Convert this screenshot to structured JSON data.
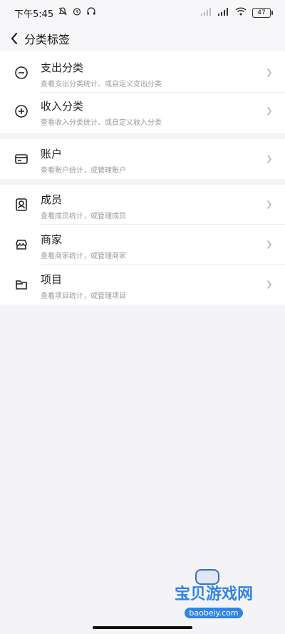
{
  "status_bar": {
    "time": "下午5:45",
    "battery": "47"
  },
  "header": {
    "title": "分类标签"
  },
  "sections": [
    {
      "items": [
        {
          "title": "支出分类",
          "subtitle": "查看支出分类统计、或自定义支出分类",
          "icon": "minus-circle-icon"
        },
        {
          "title": "收入分类",
          "subtitle": "查看收入分类统计、或自定义收入分类",
          "icon": "plus-circle-icon"
        }
      ]
    },
    {
      "items": [
        {
          "title": "账户",
          "subtitle": "查看账户统计，或管理账户",
          "icon": "card-icon"
        }
      ]
    },
    {
      "items": [
        {
          "title": "成员",
          "subtitle": "查看成员统计，或管理成员",
          "icon": "member-icon"
        },
        {
          "title": "商家",
          "subtitle": "查看商家统计，或管理商家",
          "icon": "store-icon"
        },
        {
          "title": "项目",
          "subtitle": "查看项目统计，或管理项目",
          "icon": "folder-icon"
        }
      ]
    }
  ],
  "watermark": {
    "main": "宝贝游戏网",
    "sub": "baobeiy.com"
  }
}
